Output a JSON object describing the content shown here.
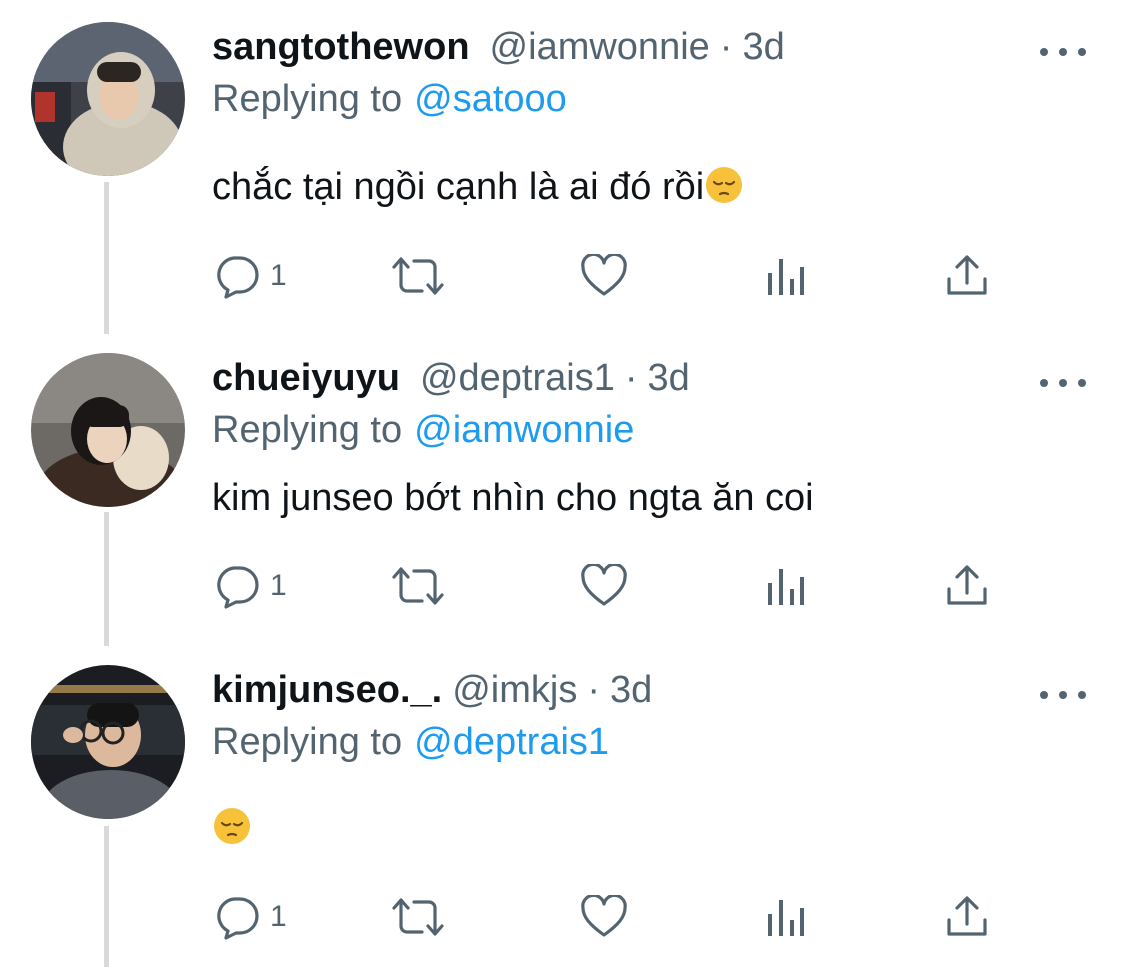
{
  "tweets": [
    {
      "display_name": "sangtothewon",
      "handle": "@iamwonnie",
      "separator": "·",
      "time": "3d",
      "reply_prefix": "Replying to",
      "reply_to": "@satooo",
      "text": "chắc tại ngồi cạnh là ai đó rồi",
      "emoji": "pensive-face",
      "reply_count": "1"
    },
    {
      "display_name": "chueiyuyu",
      "handle": "@deptrais1",
      "separator": "·",
      "time": "3d",
      "reply_prefix": "Replying to",
      "reply_to": "@iamwonnie",
      "text": "kim junseo bớt nhìn cho ngta ăn coi",
      "emoji": "",
      "reply_count": "1"
    },
    {
      "display_name": "kimjunseo._.",
      "handle": "@imkjs",
      "separator": "·",
      "time": "3d",
      "reply_prefix": "Replying to",
      "reply_to": "@deptrais1",
      "text": "",
      "emoji": "pensive-face",
      "reply_count": "1"
    }
  ],
  "icons": {
    "reply": "speech-bubble-icon",
    "retweet": "retweet-icon",
    "like": "heart-icon",
    "views": "bar-chart-icon",
    "share": "share-icon",
    "more": "more-dots-icon"
  },
  "colors": {
    "text": "#0f1419",
    "secondary": "#536471",
    "link": "#1d9bf0",
    "thread_line": "#d9d9d9",
    "emoji": "#f7c23a"
  }
}
